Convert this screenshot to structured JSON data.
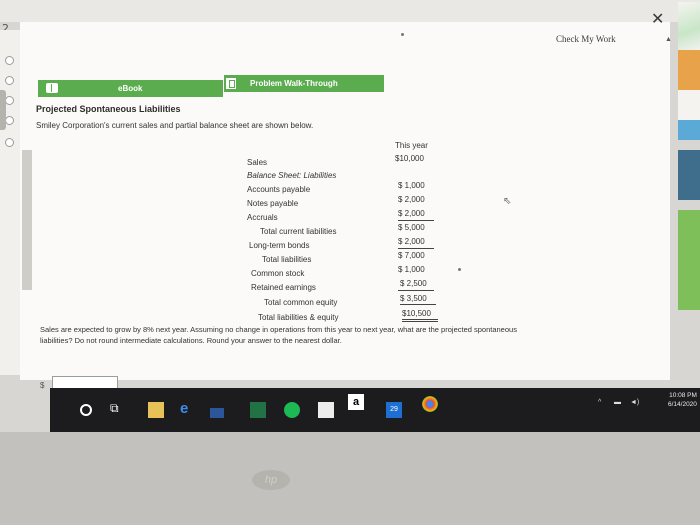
{
  "page_number": "2",
  "header": {
    "check_my_work": "Check My Work"
  },
  "tabs": [
    {
      "label": "eBook"
    },
    {
      "label": "Problem Walk-Through"
    }
  ],
  "problem": {
    "title": "Projected Spontaneous Liabilities",
    "intro": "Smiley Corporation's current sales and partial balance sheet are shown below.",
    "column_header": "This year"
  },
  "balance_sheet": {
    "sales_label": "Sales",
    "sales_value": "$10,000",
    "section_label": "Balance Sheet: Liabilities",
    "rows": [
      {
        "label": "Accounts payable",
        "value": "$ 1,000"
      },
      {
        "label": "Notes payable",
        "value": "$ 2,000"
      },
      {
        "label": "Accruals",
        "value": "$ 2,000"
      },
      {
        "label": "Total current liabilities",
        "value": "$ 5,000"
      },
      {
        "label": "Long-term bonds",
        "value": "$ 2,000"
      },
      {
        "label": "Total liabilities",
        "value": "$ 7,000"
      },
      {
        "label": "Common stock",
        "value": "$ 1,000"
      },
      {
        "label": "Retained earnings",
        "value": "$ 2,500"
      },
      {
        "label": "Total common equity",
        "value": "$ 3,500"
      },
      {
        "label": "Total liabilities & equity",
        "value": "$10,500"
      }
    ]
  },
  "question": {
    "line1": "Sales are expected to grow by 8% next year. Assuming no change in operations from this year to next year, what are the projected spontaneous",
    "line2": "liabilities? Do not round intermediate calculations. Round your answer to the nearest dollar.",
    "currency_symbol": "$",
    "answer_value": ""
  },
  "taskbar": {
    "time": "10:08 PM",
    "date": "6/14/2020",
    "mail_badge": "29",
    "store_letter": "a",
    "icons": [
      "cortana-icon",
      "task-view-icon",
      "file-explorer-icon",
      "edge-icon",
      "word-icon",
      "excel-icon",
      "spotify-icon",
      "store-icon",
      "amazon-icon",
      "mail-icon",
      "chrome-icon"
    ]
  },
  "brand": {
    "logo": "hp"
  },
  "colors": {
    "tab_green": "#5bab4f",
    "taskbar": "#1c1c1f",
    "page_bg": "#fbfaf8"
  }
}
